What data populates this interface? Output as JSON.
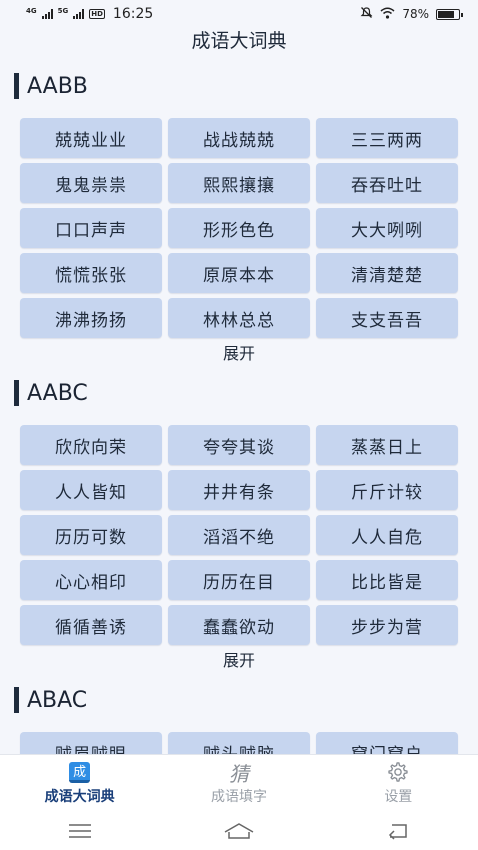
{
  "status_bar": {
    "network_1": "4G",
    "network_2": "5G",
    "hd": "HD",
    "time": "16:25",
    "battery_text": "78%",
    "battery_level": 0.78
  },
  "header": {
    "title": "成语大词典"
  },
  "sections": [
    {
      "title": "AABB",
      "items": [
        "兢兢业业",
        "战战兢兢",
        "三三两两",
        "鬼鬼祟祟",
        "熙熙攘攘",
        "吞吞吐吐",
        "口口声声",
        "形形色色",
        "大大咧咧",
        "慌慌张张",
        "原原本本",
        "清清楚楚",
        "沸沸扬扬",
        "林林总总",
        "支支吾吾"
      ],
      "expand_label": "展开"
    },
    {
      "title": "AABC",
      "items": [
        "欣欣向荣",
        "夸夸其谈",
        "蒸蒸日上",
        "人人皆知",
        "井井有条",
        "斤斤计较",
        "历历可数",
        "滔滔不绝",
        "人人自危",
        "心心相印",
        "历历在目",
        "比比皆是",
        "循循善诱",
        "蠢蠢欲动",
        "步步为营"
      ],
      "expand_label": "展开"
    },
    {
      "title": "ABAC",
      "items": [
        "贼眉贼眼",
        "贼头贼脑",
        "窟门窟户"
      ]
    }
  ],
  "tabbar": {
    "tabs": [
      {
        "label": "成语大词典",
        "icon_glyph": "成",
        "icon": "dictionary-icon",
        "active": true
      },
      {
        "label": "成语填字",
        "icon_glyph": "猜",
        "icon": "fill-word-icon",
        "active": false
      },
      {
        "label": "设置",
        "icon": "gear-icon",
        "active": false
      }
    ]
  },
  "colors": {
    "chip_bg": "#c6d5ef",
    "active_tab": "#1a3f7a",
    "inactive_tab": "#9aa0a8",
    "accent_icon": "#2f8de4"
  }
}
